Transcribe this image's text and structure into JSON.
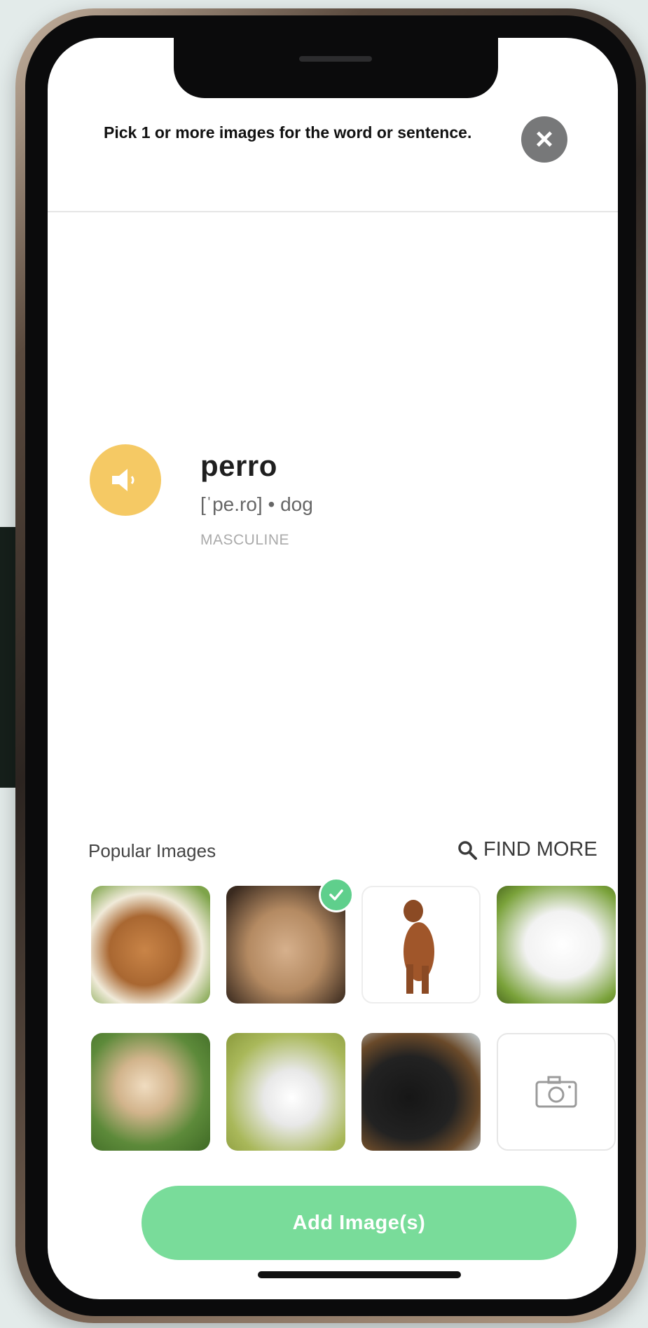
{
  "header": {
    "instruction": "Pick 1 or more images for the word or sentence.",
    "close_icon": "close-icon"
  },
  "word_card": {
    "word": "perro",
    "pronunciation": "[ˈpe.ro] • dog",
    "gender": "MASCULINE",
    "speaker_icon": "speaker-icon",
    "accent_color": "#f5c964"
  },
  "images_section": {
    "label": "Popular Images",
    "find_more_label": "FIND MORE",
    "find_more_icon": "search-icon",
    "selected_index": 1,
    "tiles": [
      {
        "name": "dachshund-puppy"
      },
      {
        "name": "fluffy-brown-puppy"
      },
      {
        "name": "brown-dog-sitting"
      },
      {
        "name": "white-maltese-dog"
      },
      {
        "name": "golden-retriever-puppy"
      },
      {
        "name": "white-terrier-dog"
      },
      {
        "name": "rottweiler-dog"
      },
      {
        "name": "camera-upload",
        "icon": "camera-icon"
      }
    ],
    "check_color": "#5fcf8c"
  },
  "footer": {
    "add_button_label": "Add Image(s)",
    "button_color": "#79dc9a"
  }
}
